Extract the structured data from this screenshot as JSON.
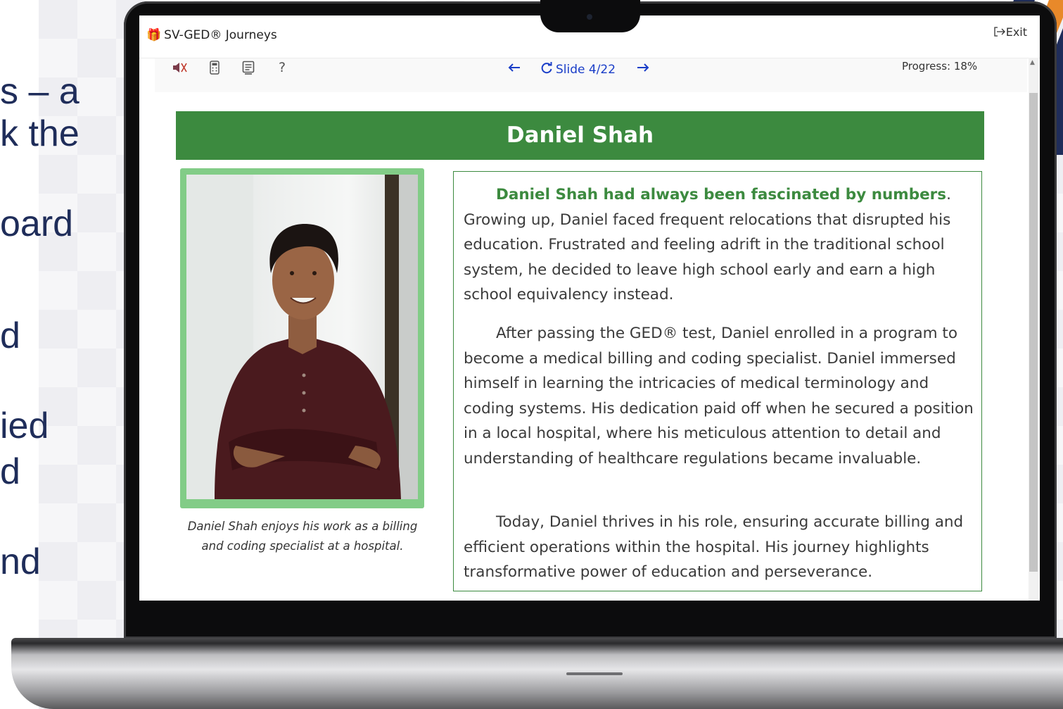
{
  "background_slide": {
    "text_fragments": [
      "s – a",
      "k the",
      "oard",
      "d",
      "ied",
      "d",
      "nd"
    ]
  },
  "app": {
    "title": "SV-GED® Journeys",
    "exit_label": "Exit"
  },
  "toolbar": {
    "icons": [
      "mute-icon",
      "calculator-icon",
      "notes-icon",
      "help-icon"
    ],
    "help_label": "?",
    "slide_label": "Slide 4/22",
    "progress_label": "Progress: 18%",
    "progress_value": 0.18
  },
  "content": {
    "heading": "Daniel Shah",
    "caption": "Daniel Shah enjoys his work as a billing and coding specialist at a hospital.",
    "paragraphs": {
      "p1_lead": "Daniel Shah had always been fascinated by numbers",
      "p1_rest": ". Growing up, Daniel faced frequent relocations that disrupted his education. Frustrated and feeling adrift in the traditional school system, he decided to leave high school early and earn a high school equivalency instead.",
      "p2": "After passing the GED® test, Daniel enrolled in a program to become a medical billing and coding specialist. Daniel immersed himself in learning the intricacies of medical terminology and coding systems. His dedication paid off when he secured a position in a local hospital, where his meticulous attention to detail and understanding of healthcare regulations became invaluable.",
      "p3": "Today, Daniel thrives in his role, ensuring accurate billing and efficient operations within the hospital. His journey highlights transformative power of education and perseverance."
    }
  },
  "colors": {
    "accent_green": "#3c8a3f",
    "frame_green": "#82cc87",
    "nav_blue": "#1a3ec8",
    "slide_navy": "#1f2d5a"
  }
}
